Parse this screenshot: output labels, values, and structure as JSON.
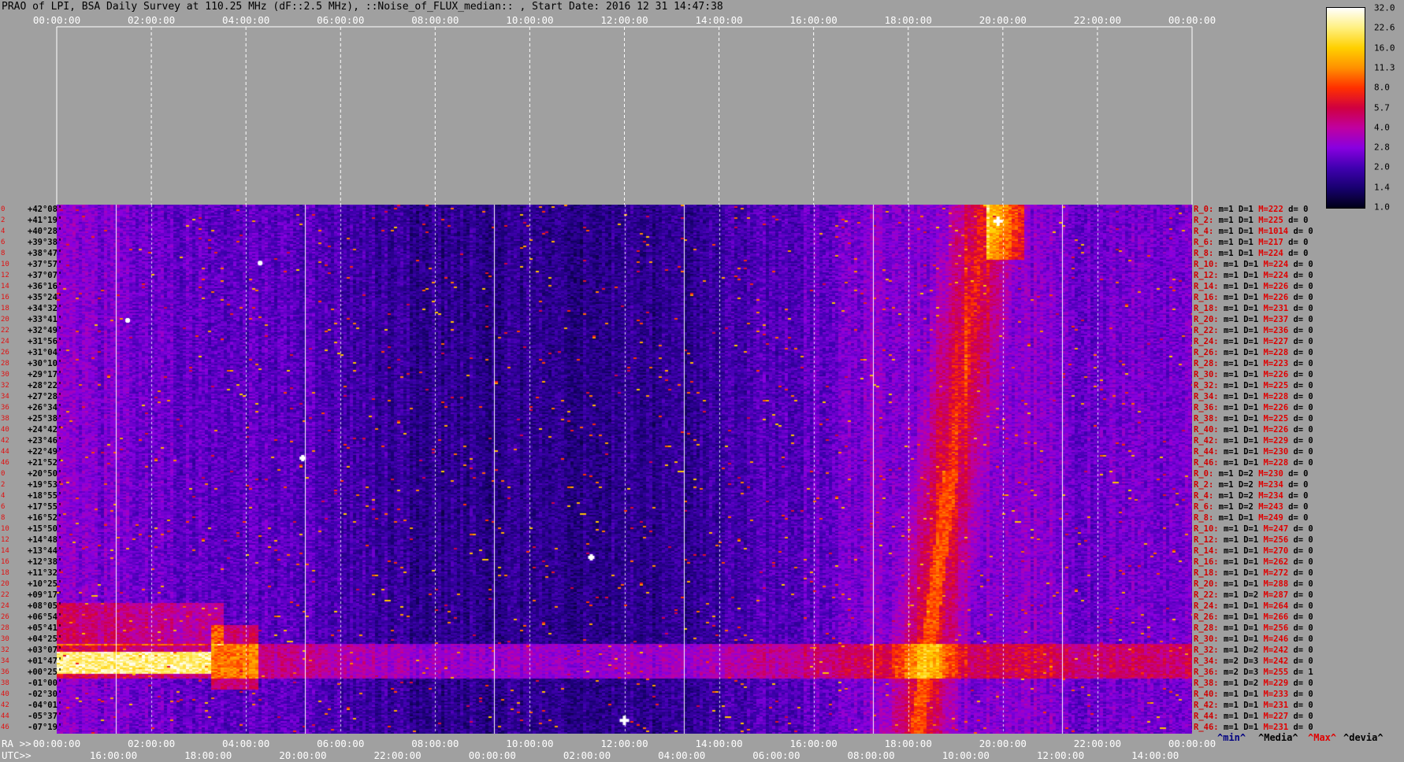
{
  "header": {
    "title": "PRAO of LPI, BSA Daily Survey at 110.25 MHz (dF::2.5 MHz), ::Noise_of_FLUX_median:: , Start Date: 2016 12 31 14:47:38"
  },
  "axes": {
    "top_ticks": [
      "00:00:00",
      "02:00:00",
      "04:00:00",
      "06:00:00",
      "08:00:00",
      "10:00:00",
      "12:00:00",
      "14:00:00",
      "16:00:00",
      "18:00:00",
      "20:00:00",
      "22:00:00",
      "00:00:00"
    ],
    "ra_label": "RA >>",
    "ra_ticks": [
      "00:00:00",
      "02:00:00",
      "04:00:00",
      "06:00:00",
      "08:00:00",
      "10:00:00",
      "12:00:00",
      "14:00:00",
      "16:00:00",
      "18:00:00",
      "20:00:00",
      "22:00:00",
      "00:00:00"
    ],
    "utc_label": "UTC>>",
    "utc_ticks": [
      "16:00:00",
      "18:00:00",
      "20:00:00",
      "22:00:00",
      "00:00:00",
      "02:00:00",
      "04:00:00",
      "06:00:00",
      "08:00:00",
      "10:00:00",
      "12:00:00",
      "14:00:00"
    ]
  },
  "colorbar": {
    "labels": [
      "32.0",
      "22.6",
      "16.0",
      "11.3",
      "8.0",
      "5.7",
      "4.0",
      "2.8",
      "2.0",
      "1.4",
      "1.0"
    ],
    "colors": [
      "#ffffff",
      "#fff080",
      "#ffd000",
      "#ff9000",
      "#ff3000",
      "#d00040",
      "#c000a0",
      "#8800e0",
      "#4000b0",
      "#180070",
      "#000018"
    ]
  },
  "footer": {
    "min": "^min^",
    "media": "^Media^",
    "max": "^Max^",
    "devia": "^devia^"
  },
  "chart_data": {
    "type": "heatmap",
    "title": "PRAO of LPI, BSA Daily Survey at 110.25 MHz (dF::2.5 MHz), ::Noise_of_FLUX_median:: , Start Date: 2016 12 31 14:47:38",
    "x_axis": "RA / UTC time (00:00:00 to 00:00:00)",
    "declinations": [
      "+42°08'",
      "+41°19'",
      "+40°28'",
      "+39°38'",
      "+38°47'",
      "+37°57'",
      "+37°07'",
      "+36°16'",
      "+35°24'",
      "+34°32'",
      "+33°41'",
      "+32°49'",
      "+31°56'",
      "+31°04'",
      "+30°10'",
      "+29°17'",
      "+28°22'",
      "+27°28'",
      "+26°34'",
      "+25°38'",
      "+24°42'",
      "+23°46'",
      "+22°49'",
      "+21°52'",
      "+20°50'",
      "+19°53'",
      "+18°55'",
      "+17°55'",
      "+16°52'",
      "+15°50'",
      "+14°48'",
      "+13°44'",
      "+12°38'",
      "+11°32'",
      "+10°25'",
      "+09°17'",
      "+08°05'",
      "+06°54'",
      "+05°41'",
      "+04°25'",
      "+03°07'",
      "+01°47'",
      "+00°25'",
      "-01°00'",
      "-02°30'",
      "-04°01'",
      "-05°37'",
      "-07°19'"
    ],
    "row_indices": [
      "0",
      "2",
      "4",
      "6",
      "8",
      "10",
      "12",
      "14",
      "16",
      "18",
      "20",
      "22",
      "24",
      "26",
      "28",
      "30",
      "32",
      "34",
      "36",
      "38",
      "40",
      "42",
      "44",
      "46",
      "0",
      "2",
      "4",
      "6",
      "8",
      "10",
      "12",
      "14",
      "16",
      "18",
      "20",
      "22",
      "24",
      "26",
      "28",
      "30",
      "32",
      "34",
      "36",
      "38",
      "40",
      "42",
      "44",
      "46"
    ],
    "row_stats": [
      {
        "r": "R_0:",
        "m": "m=1",
        "D": "D=1",
        "M": "M=222",
        "d": "d= 0"
      },
      {
        "r": "R_2:",
        "m": "m=1",
        "D": "D=1",
        "M": "M=225",
        "d": "d= 0"
      },
      {
        "r": "R_4:",
        "m": "m=1",
        "D": "D=1",
        "M": "M=1014",
        "d": "d= 0"
      },
      {
        "r": "R_6:",
        "m": "m=1",
        "D": "D=1",
        "M": "M=217",
        "d": "d= 0"
      },
      {
        "r": "R_8:",
        "m": "m=1",
        "D": "D=1",
        "M": "M=224",
        "d": "d= 0"
      },
      {
        "r": "R_10:",
        "m": "m=1",
        "D": "D=1",
        "M": "M=224",
        "d": "d= 0"
      },
      {
        "r": "R_12:",
        "m": "m=1",
        "D": "D=1",
        "M": "M=224",
        "d": "d= 0"
      },
      {
        "r": "R_14:",
        "m": "m=1",
        "D": "D=1",
        "M": "M=226",
        "d": "d= 0"
      },
      {
        "r": "R_16:",
        "m": "m=1",
        "D": "D=1",
        "M": "M=226",
        "d": "d= 0"
      },
      {
        "r": "R_18:",
        "m": "m=1",
        "D": "D=1",
        "M": "M=231",
        "d": "d= 0"
      },
      {
        "r": "R_20:",
        "m": "m=1",
        "D": "D=1",
        "M": "M=237",
        "d": "d= 0"
      },
      {
        "r": "R_22:",
        "m": "m=1",
        "D": "D=1",
        "M": "M=236",
        "d": "d= 0"
      },
      {
        "r": "R_24:",
        "m": "m=1",
        "D": "D=1",
        "M": "M=227",
        "d": "d= 0"
      },
      {
        "r": "R_26:",
        "m": "m=1",
        "D": "D=1",
        "M": "M=228",
        "d": "d= 0"
      },
      {
        "r": "R_28:",
        "m": "m=1",
        "D": "D=1",
        "M": "M=223",
        "d": "d= 0"
      },
      {
        "r": "R_30:",
        "m": "m=1",
        "D": "D=1",
        "M": "M=226",
        "d": "d= 0"
      },
      {
        "r": "R_32:",
        "m": "m=1",
        "D": "D=1",
        "M": "M=225",
        "d": "d= 0"
      },
      {
        "r": "R_34:",
        "m": "m=1",
        "D": "D=1",
        "M": "M=228",
        "d": "d= 0"
      },
      {
        "r": "R_36:",
        "m": "m=1",
        "D": "D=1",
        "M": "M=226",
        "d": "d= 0"
      },
      {
        "r": "R_38:",
        "m": "m=1",
        "D": "D=1",
        "M": "M=225",
        "d": "d= 0"
      },
      {
        "r": "R_40:",
        "m": "m=1",
        "D": "D=1",
        "M": "M=226",
        "d": "d= 0"
      },
      {
        "r": "R_42:",
        "m": "m=1",
        "D": "D=1",
        "M": "M=229",
        "d": "d= 0"
      },
      {
        "r": "R_44:",
        "m": "m=1",
        "D": "D=1",
        "M": "M=230",
        "d": "d= 0"
      },
      {
        "r": "R_46:",
        "m": "m=1",
        "D": "D=1",
        "M": "M=228",
        "d": "d= 0"
      },
      {
        "r": "R_0:",
        "m": "m=1",
        "D": "D=2",
        "M": "M=230",
        "d": "d= 0"
      },
      {
        "r": "R_2:",
        "m": "m=1",
        "D": "D=2",
        "M": "M=234",
        "d": "d= 0"
      },
      {
        "r": "R_4:",
        "m": "m=1",
        "D": "D=2",
        "M": "M=234",
        "d": "d= 0"
      },
      {
        "r": "R_6:",
        "m": "m=1",
        "D": "D=2",
        "M": "M=243",
        "d": "d= 0"
      },
      {
        "r": "R_8:",
        "m": "m=1",
        "D": "D=1",
        "M": "M=249",
        "d": "d= 0"
      },
      {
        "r": "R_10:",
        "m": "m=1",
        "D": "D=1",
        "M": "M=247",
        "d": "d= 0"
      },
      {
        "r": "R_12:",
        "m": "m=1",
        "D": "D=1",
        "M": "M=256",
        "d": "d= 0"
      },
      {
        "r": "R_14:",
        "m": "m=1",
        "D": "D=1",
        "M": "M=270",
        "d": "d= 0"
      },
      {
        "r": "R_16:",
        "m": "m=1",
        "D": "D=1",
        "M": "M=262",
        "d": "d= 0"
      },
      {
        "r": "R_18:",
        "m": "m=1",
        "D": "D=1",
        "M": "M=272",
        "d": "d= 0"
      },
      {
        "r": "R_20:",
        "m": "m=1",
        "D": "D=1",
        "M": "M=288",
        "d": "d= 0"
      },
      {
        "r": "R_22:",
        "m": "m=1",
        "D": "D=2",
        "M": "M=287",
        "d": "d= 0"
      },
      {
        "r": "R_24:",
        "m": "m=1",
        "D": "D=1",
        "M": "M=264",
        "d": "d= 0"
      },
      {
        "r": "R_26:",
        "m": "m=1",
        "D": "D=1",
        "M": "M=266",
        "d": "d= 0"
      },
      {
        "r": "R_28:",
        "m": "m=1",
        "D": "D=1",
        "M": "M=256",
        "d": "d= 0"
      },
      {
        "r": "R_30:",
        "m": "m=1",
        "D": "D=1",
        "M": "M=246",
        "d": "d= 0"
      },
      {
        "r": "R_32:",
        "m": "m=1",
        "D": "D=2",
        "M": "M=242",
        "d": "d= 0"
      },
      {
        "r": "R_34:",
        "m": "m=2",
        "D": "D=3",
        "M": "M=242",
        "d": "d= 0"
      },
      {
        "r": "R_36:",
        "m": "m=2",
        "D": "D=3",
        "M": "M=255",
        "d": "d= 1"
      },
      {
        "r": "R_38:",
        "m": "m=1",
        "D": "D=2",
        "M": "M=229",
        "d": "d= 0"
      },
      {
        "r": "R_40:",
        "m": "m=1",
        "D": "D=1",
        "M": "M=233",
        "d": "d= 0"
      },
      {
        "r": "R_42:",
        "m": "m=1",
        "D": "D=1",
        "M": "M=231",
        "d": "d= 0"
      },
      {
        "r": "R_44:",
        "m": "m=1",
        "D": "D=1",
        "M": "M=227",
        "d": "d= 0"
      },
      {
        "r": "R_46:",
        "m": "m=1",
        "D": "D=1",
        "M": "M=231",
        "d": "d= 0"
      }
    ],
    "colorscale": {
      "min": 1.0,
      "max": 32.0,
      "scale": "log"
    }
  }
}
